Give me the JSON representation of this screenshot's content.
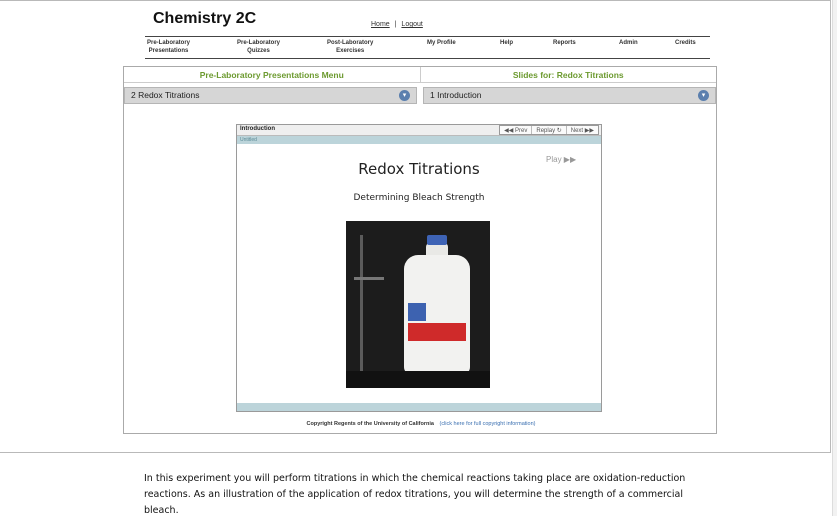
{
  "header": {
    "site_title": "Chemistry 2C",
    "links": {
      "home": "Home",
      "separator": "|",
      "logout": "Logout"
    }
  },
  "nav": {
    "items": [
      {
        "line1": "Pre-Laboratory",
        "line2": "Presentations"
      },
      {
        "line1": "Pre-Laboratory",
        "line2": "Quizzes"
      },
      {
        "line1": "Post-Laboratory",
        "line2": "Exercises"
      },
      {
        "line1": "My Profile",
        "line2": ""
      },
      {
        "line1": "Help",
        "line2": ""
      },
      {
        "line1": "Reports",
        "line2": ""
      },
      {
        "line1": "Admin",
        "line2": ""
      },
      {
        "line1": "Credits",
        "line2": ""
      }
    ]
  },
  "menus": {
    "left_header": "Pre-Laboratory Presentations Menu",
    "right_header": "Slides for: Redox Titrations",
    "left_selected": "2  Redox Titrations",
    "right_selected": "1  Introduction"
  },
  "player": {
    "slide_title": "Introduction",
    "sub_label": "Untitled",
    "controls": {
      "prev": "◀◀ Prev",
      "replay": "Replay ↻",
      "next": "Next ▶▶"
    },
    "play": "Play ▶▶",
    "heading": "Redox Titrations",
    "subheading": "Determining Bleach Strength"
  },
  "footer": {
    "copyright": "Copyright Regents of the University of California",
    "copyright_link": "(click here for full copyright information)"
  },
  "description": {
    "text": "In this experiment you will perform titrations in which the chemical reactions taking place are oxidation-reduction reactions. As an illustration of the application of redox titrations, you will determine the strength of a commercial bleach."
  },
  "colors": {
    "menu_header_green": "#6c9a2f",
    "select_arrow_blue": "#5b7fae",
    "player_bar_teal": "#bcd4da"
  }
}
